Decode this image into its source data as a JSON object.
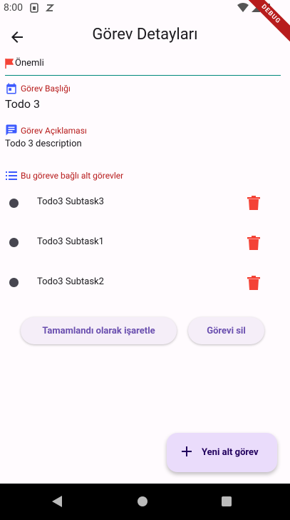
{
  "status_bar": {
    "time": "8:00"
  },
  "debug_banner": "DEBUG",
  "app_bar": {
    "title": "Görev Detayları"
  },
  "priority": {
    "label": "Önemli"
  },
  "task_title": {
    "label": "Görev Başlığı",
    "value": "Todo 3"
  },
  "task_description": {
    "label": "Görev Açıklaması",
    "value": "Todo 3 description"
  },
  "subtasks": {
    "header": "Bu göreve bağlı alt görevler",
    "items": [
      {
        "name": "Todo3 Subtask3"
      },
      {
        "name": "Todo3 Subtask1"
      },
      {
        "name": "Todo3 Subtask2"
      }
    ]
  },
  "actions": {
    "complete": "Tamamlandı olarak işaretle",
    "delete": "Görevi sil"
  },
  "fab": {
    "label": "Yeni alt görev"
  },
  "colors": {
    "accent": "#6a4faf",
    "danger": "#f44336",
    "section_label": "#b71c1c",
    "icon_blue": "#3d5afe"
  }
}
